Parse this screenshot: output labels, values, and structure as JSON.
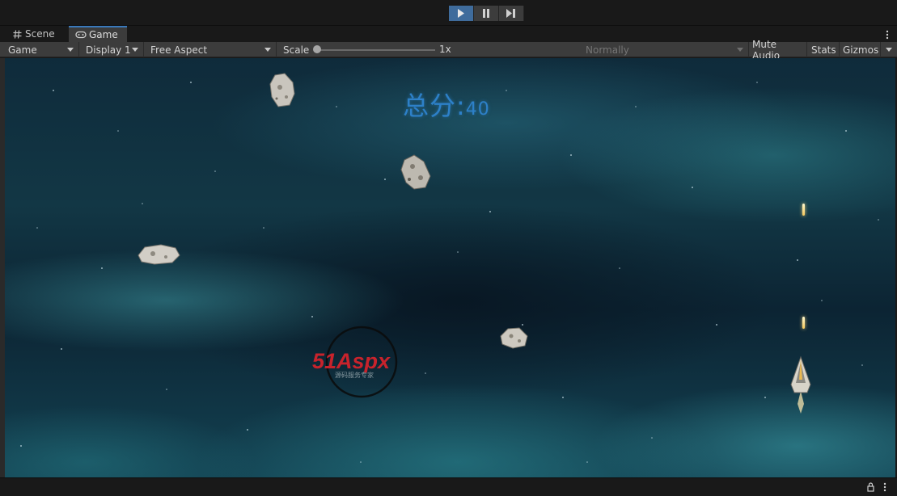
{
  "playbar": {
    "play_icon": "play-icon",
    "pause_icon": "pause-icon",
    "step_icon": "step-icon"
  },
  "tabs": [
    {
      "label": "Scene",
      "icon": "hash-icon"
    },
    {
      "label": "Game",
      "icon": "gamepad-icon"
    }
  ],
  "toolbar": {
    "view_dropdown": "Game",
    "display_dropdown": "Display 1",
    "aspect_dropdown": "Free Aspect",
    "scale_label": "Scale",
    "scale_value": "1x",
    "play_mode_dropdown": "Normally",
    "mute_audio": "Mute Audio",
    "stats": "Stats",
    "gizmos": "Gizmos"
  },
  "game": {
    "score_label": "总分:",
    "score_value": "40",
    "watermark_main": "51Aspx",
    "watermark_sub": "源码服务专家"
  },
  "colors": {
    "accent": "#3f6c9c",
    "score_text": "#2d80c8",
    "toolbar_bg": "#3c3c3c"
  }
}
